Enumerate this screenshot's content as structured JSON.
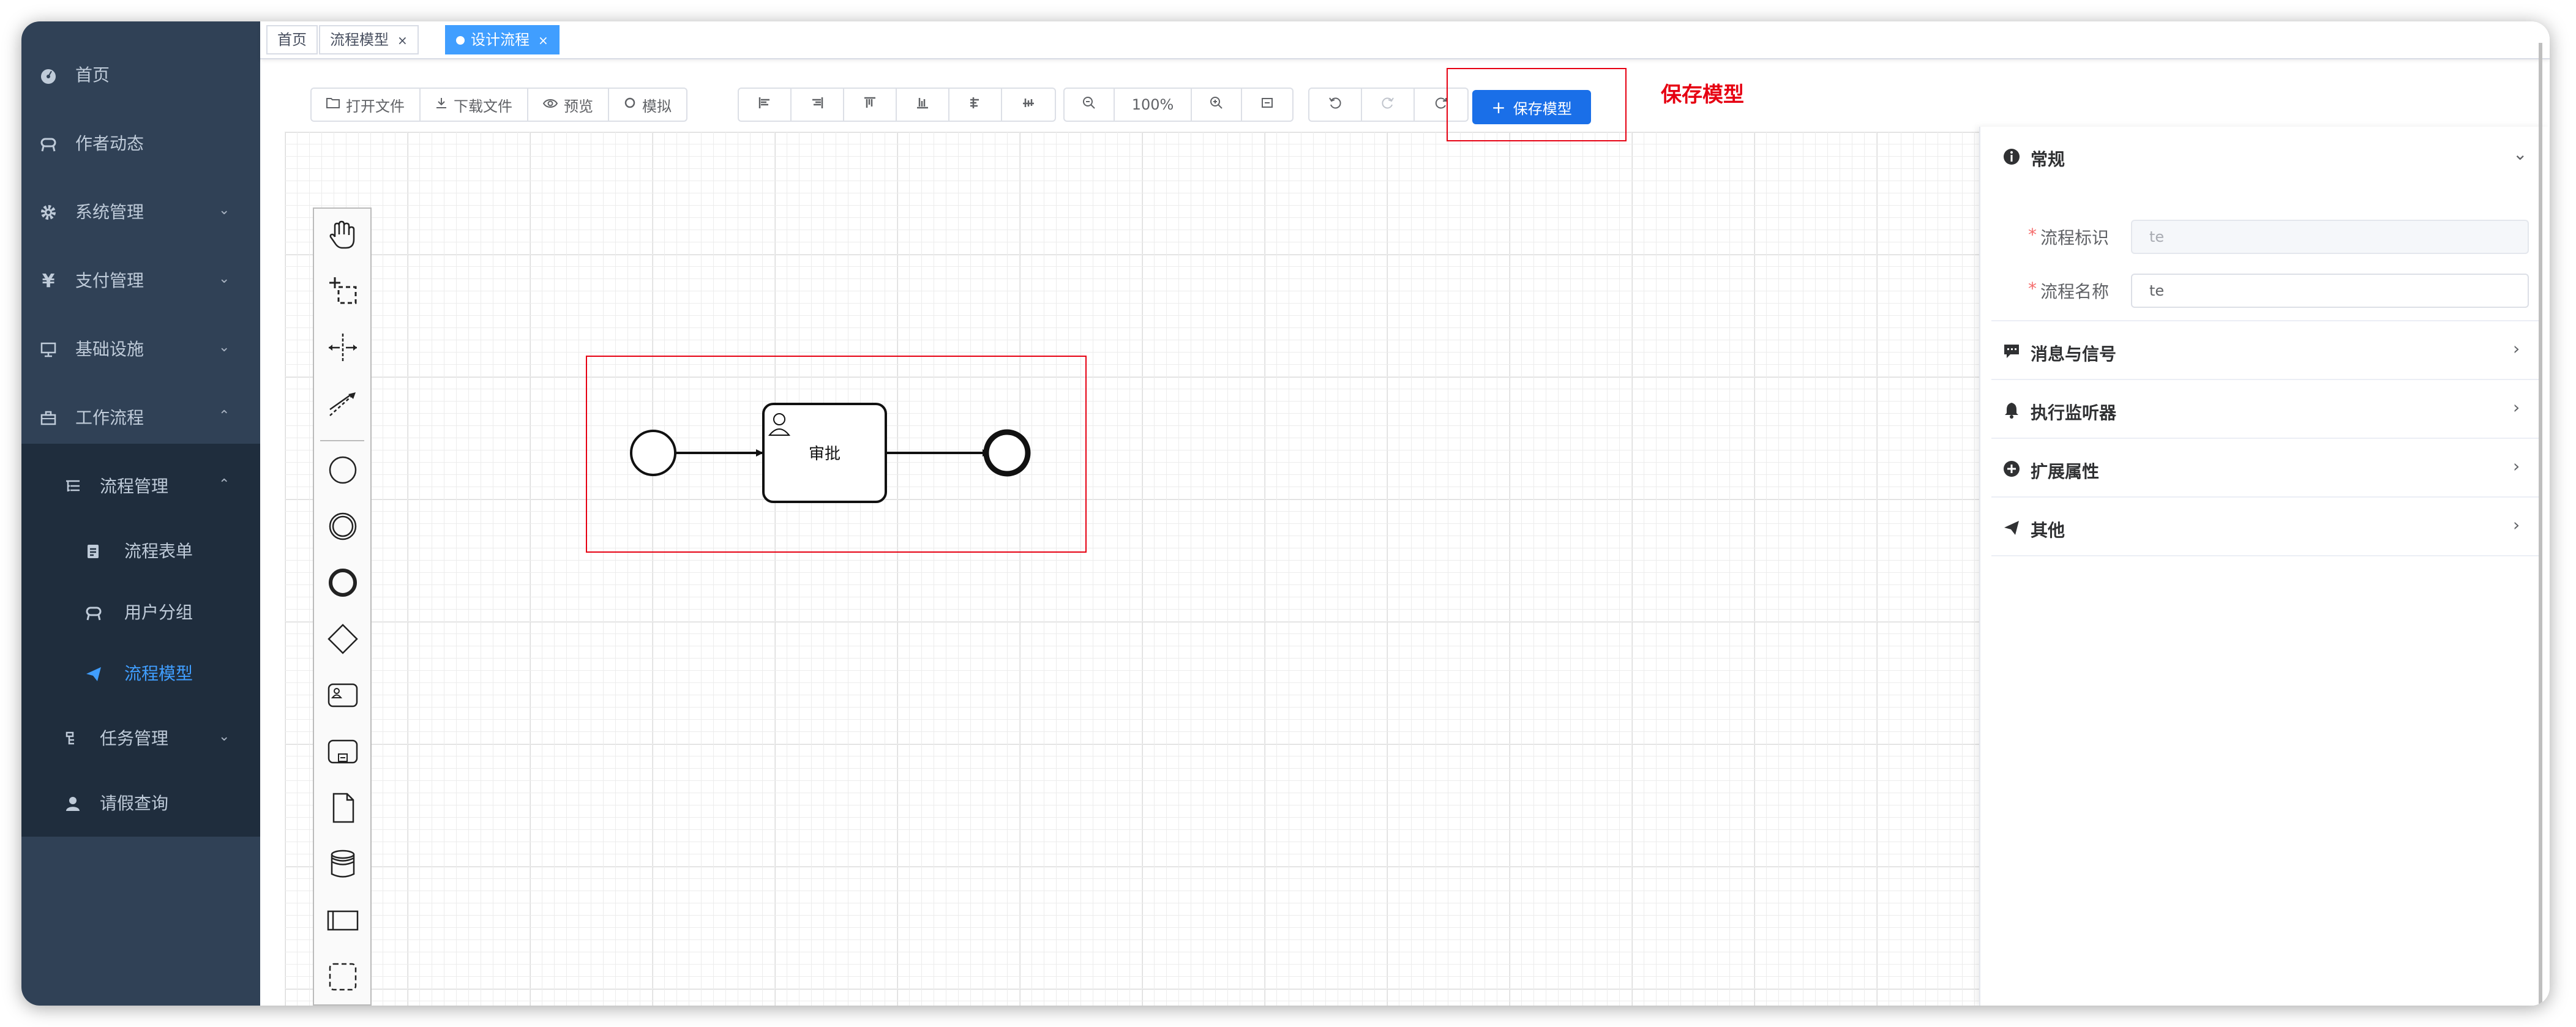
{
  "sidebar": {
    "items": [
      {
        "label": "首页",
        "icon": "dashboard-icon"
      },
      {
        "label": "作者动态",
        "icon": "guide-icon"
      },
      {
        "label": "系统管理",
        "icon": "system-icon"
      },
      {
        "label": "支付管理",
        "icon": "yen-icon"
      },
      {
        "label": "基础设施",
        "icon": "monitor-icon"
      },
      {
        "label": "工作流程",
        "icon": "briefcase-icon"
      },
      {
        "label": "流程管理",
        "icon": "tree-table-icon"
      },
      {
        "label": "流程表单",
        "icon": "form-icon"
      },
      {
        "label": "用户分组",
        "icon": "peoples-icon"
      },
      {
        "label": "流程模型",
        "icon": "send-icon"
      },
      {
        "label": "任务管理",
        "icon": "tree-icon"
      },
      {
        "label": "请假查询",
        "icon": "user-icon"
      }
    ]
  },
  "tags": [
    {
      "label": "首页"
    },
    {
      "label": "流程模型",
      "close": "×"
    },
    {
      "label": "设计流程",
      "close": "×"
    }
  ],
  "toolbar": {
    "open_file": "打开文件",
    "download_file": "下载文件",
    "preview": "预览",
    "simulate": "模拟",
    "zoom": "100%",
    "save": "保存模型",
    "save_plus": "+"
  },
  "annotation": {
    "save_note": "保存模型"
  },
  "diagram": {
    "task_label": "审批"
  },
  "panel": {
    "general": {
      "title": "常规",
      "required": "*",
      "id_label": "流程标识",
      "id_value": "te",
      "name_label": "流程名称",
      "name_value": "te"
    },
    "sections": [
      {
        "title": "消息与信号"
      },
      {
        "title": "执行监听器"
      },
      {
        "title": "扩展属性"
      },
      {
        "title": "其他"
      }
    ]
  },
  "colors": {
    "sidebar_bg": "#304156",
    "submenu_bg": "#1f2d3d",
    "active": "#409eff",
    "primary": "#1a6fe8",
    "annotation_red": "#e60012"
  }
}
